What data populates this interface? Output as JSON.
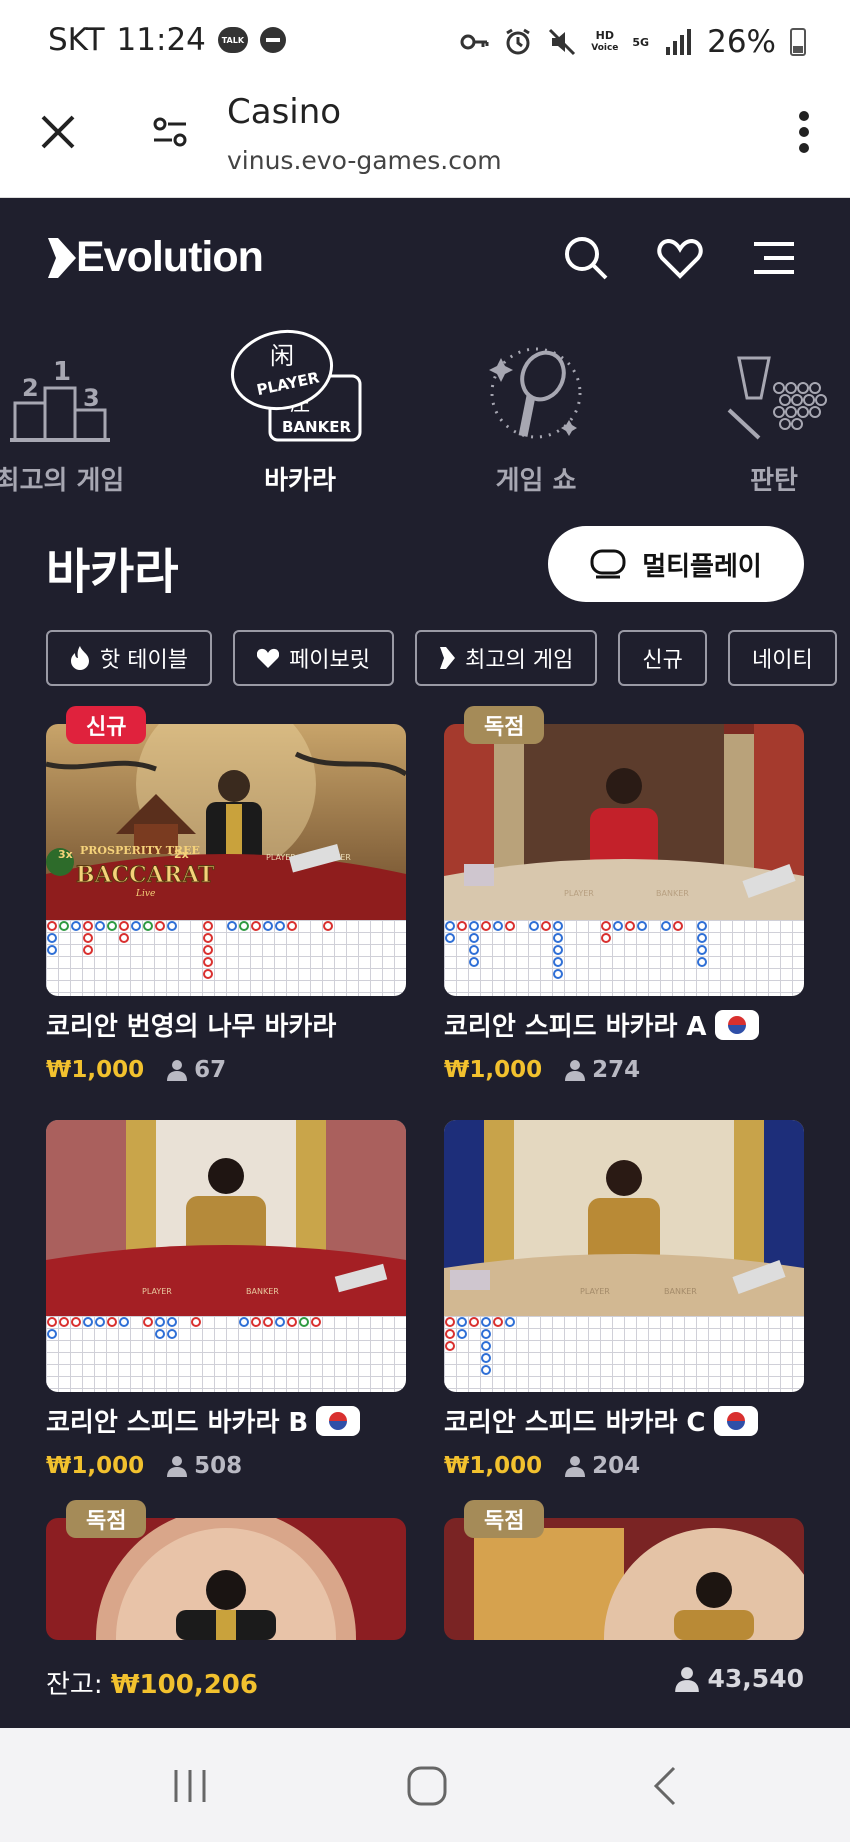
{
  "status_bar": {
    "carrier": "SKT",
    "time": "11:24",
    "talk_badge": "TALK",
    "hd_label": "HD",
    "voice_label": "Voice",
    "network": "5G",
    "battery": "26%"
  },
  "browser": {
    "title": "Casino",
    "url": "vinus.evo-games.com"
  },
  "app": {
    "brand": "Evolution",
    "categories": [
      {
        "label": "최고의 게임",
        "icon": "podium-icon",
        "active": false
      },
      {
        "label": "바카라",
        "icon": "baccarat-icon",
        "active": true
      },
      {
        "label": "게임 쇼",
        "icon": "microphone-icon",
        "active": false
      },
      {
        "label": "판탄",
        "icon": "fantan-icon",
        "active": false
      }
    ],
    "baccarat_icon_text": {
      "top": "闲",
      "player": "PLAYER",
      "bottom": "庄",
      "banker": "BANKER"
    },
    "section_title": "바카라",
    "multiplay_label": "멀티플레이",
    "chips": [
      {
        "label": "핫 테이블",
        "icon": "flame-icon"
      },
      {
        "label": "페이보릿",
        "icon": "heart-icon"
      },
      {
        "label": "최고의 게임",
        "icon": "evolution-mark-icon"
      },
      {
        "label": "신규",
        "icon": ""
      },
      {
        "label": "네이티",
        "icon": ""
      }
    ]
  },
  "games": [
    {
      "name": "코리안 번영의 나무 바카라",
      "badge": "신규",
      "badge_type": "new",
      "flag": false,
      "price": "₩1,000",
      "players": "67",
      "overlay_mult_left": "3x",
      "overlay_title": "PROSPERITY TREE",
      "overlay_mult_right": "2x",
      "overlay_game": "BACCARAT",
      "overlay_sub": "Live",
      "player_label": "PLAYER",
      "banker_label": "BANKER"
    },
    {
      "name": "코리안 스피드 바카라 A",
      "badge": "독점",
      "badge_type": "excl",
      "flag": true,
      "price": "₩1,000",
      "players": "274",
      "player_label": "PLAYER",
      "banker_label": "BANKER"
    },
    {
      "name": "코리안 스피드 바카라 B",
      "badge": "",
      "badge_type": "",
      "flag": true,
      "price": "₩1,000",
      "players": "508",
      "player_label": "PLAYER",
      "banker_label": "BANKER"
    },
    {
      "name": "코리안 스피드 바카라 C",
      "badge": "",
      "badge_type": "",
      "flag": true,
      "price": "₩1,000",
      "players": "204",
      "player_label": "PLAYER",
      "banker_label": "BANKER"
    },
    {
      "name": "",
      "badge": "독점",
      "badge_type": "excl",
      "flag": false,
      "price": "",
      "players": ""
    },
    {
      "name": "",
      "badge": "독점",
      "badge_type": "excl",
      "flag": false,
      "price": "",
      "players": ""
    }
  ],
  "footer": {
    "balance_label": "잔고:",
    "balance_value": "₩100,206",
    "online_count": "43,540"
  },
  "colors": {
    "background": "#1f1f2d",
    "price": "#f2c12e",
    "new_badge": "#e0223d",
    "exclusive_badge": "#a58b58",
    "player_bead": "#2f6fd6",
    "banker_bead": "#d9302f"
  }
}
